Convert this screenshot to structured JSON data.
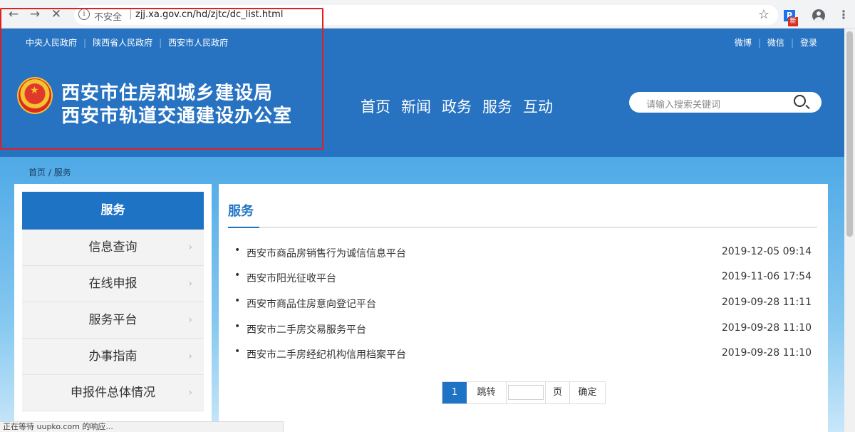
{
  "browser": {
    "back_icon": "←",
    "forward_icon": "→",
    "reload_icon": "✕",
    "info_icon": "i",
    "security_text": "不安全",
    "url": "zjj.xa.gov.cn/hd/zjtc/dc_list.html",
    "star_icon": "☆",
    "extension_label": "P",
    "extension_badge": "新",
    "menu_icon": "⋮",
    "status_text": "正在等待 uupko.com 的响应..."
  },
  "top_links": [
    "中央人民政府",
    "陕西省人民政府",
    "西安市人民政府"
  ],
  "right_links": [
    "微博",
    "微信",
    "登录"
  ],
  "site": {
    "title_line1": "西安市住房和城乡建设局",
    "title_line2": "西安市轨道交通建设办公室"
  },
  "main_nav": [
    "首页",
    "新闻",
    "政务",
    "服务",
    "互动"
  ],
  "search": {
    "placeholder": "请输入搜索关键词"
  },
  "breadcrumb": {
    "home": "首页",
    "separator": "/",
    "current": "服务"
  },
  "sidebar": {
    "heading": "服务",
    "items": [
      {
        "label": "信息查询"
      },
      {
        "label": "在线申报"
      },
      {
        "label": "服务平台"
      },
      {
        "label": "办事指南"
      },
      {
        "label": "申报件总体情况"
      }
    ],
    "arrow": "›"
  },
  "content": {
    "title": "服务",
    "bullet": "•",
    "rows": [
      {
        "title": "西安市商品房销售行为诚信信息平台",
        "date": "2019-12-05 09:14"
      },
      {
        "title": "西安市阳光征收平台",
        "date": "2019-11-06 17:54"
      },
      {
        "title": "西安市商品住房意向登记平台",
        "date": "2019-09-28 11:11"
      },
      {
        "title": "西安市二手房交易服务平台",
        "date": "2019-09-28 11:10"
      },
      {
        "title": "西安市二手房经纪机构信用档案平台",
        "date": "2019-09-28 11:10"
      }
    ]
  },
  "pager": {
    "current": "1",
    "jump_label": "跳转",
    "page_label": "页",
    "confirm_label": "确定"
  }
}
